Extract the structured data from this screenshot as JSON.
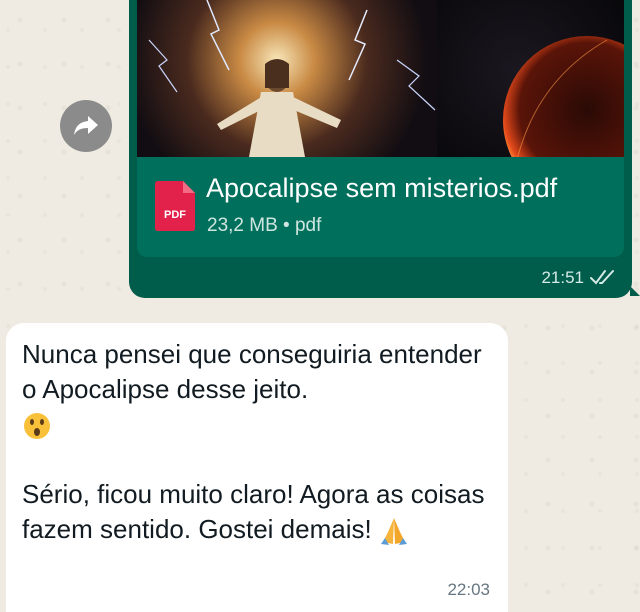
{
  "outgoing_message": {
    "document": {
      "file_name": "Apocalipse sem misterios.pdf",
      "file_size": "23,2 MB",
      "separator": "•",
      "file_type": "pdf",
      "icon": "pdf-file-icon",
      "icon_label": "PDF"
    },
    "time": "21:51",
    "status_icon": "double-check-read-icon"
  },
  "forward_icon": "forward-arrow-icon",
  "incoming_message": {
    "line1": "Nunca pensei que conseguiria entender o Apocalipse desse jeito.",
    "emoji1": "astonished-face-emoji",
    "line2": "Sério, ficou muito claro! Agora as coisas fazem sentido. Gostei demais!",
    "emoji2": "folded-hands-emoji",
    "time": "22:03"
  },
  "colors": {
    "chat_background": "#efeae2",
    "outgoing_bubble": "#005c4b",
    "incoming_bubble": "#ffffff",
    "pdf_red": "#e2224a"
  }
}
